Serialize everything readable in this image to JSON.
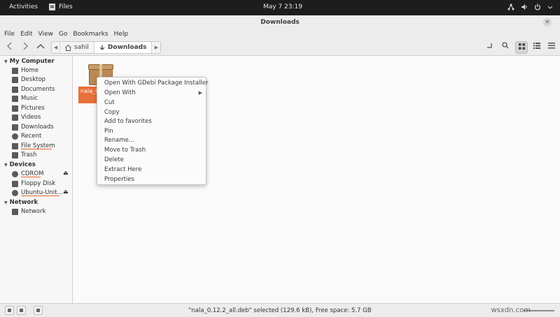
{
  "topbar": {
    "activities": "Activities",
    "app_name": "Files",
    "clock": "May 7  23:19"
  },
  "window": {
    "title": "Downloads"
  },
  "menubar": [
    "File",
    "Edit",
    "View",
    "Go",
    "Bookmarks",
    "Help"
  ],
  "breadcrumb": {
    "home": "sahil",
    "current": "Downloads"
  },
  "sidebar": {
    "my_computer": {
      "heading": "My Computer",
      "items": [
        "Home",
        "Desktop",
        "Documents",
        "Music",
        "Pictures",
        "Videos",
        "Downloads",
        "Recent",
        "File System",
        "Trash"
      ]
    },
    "devices": {
      "heading": "Devices",
      "items": [
        "CDROM",
        "Floppy Disk",
        "Ubuntu-Unit..."
      ]
    },
    "network": {
      "heading": "Network",
      "items": [
        "Network"
      ]
    }
  },
  "file": {
    "label": "nala_0"
  },
  "context_menu": {
    "items": [
      "Open With GDebi Package Installer",
      "Open With",
      "Cut",
      "Copy",
      "Add to favorites",
      "Pin",
      "Rename...",
      "Move to Trash",
      "Delete",
      "Extract Here",
      "Properties"
    ]
  },
  "statusbar": {
    "text": "\"nala_0.12.2_all.deb\" selected (129.6 kB), Free space: 5.7 GB"
  },
  "watermark": "wsxdn.com",
  "colors": {
    "accent": "#e8703a",
    "topbar": "#1d1d1d"
  }
}
